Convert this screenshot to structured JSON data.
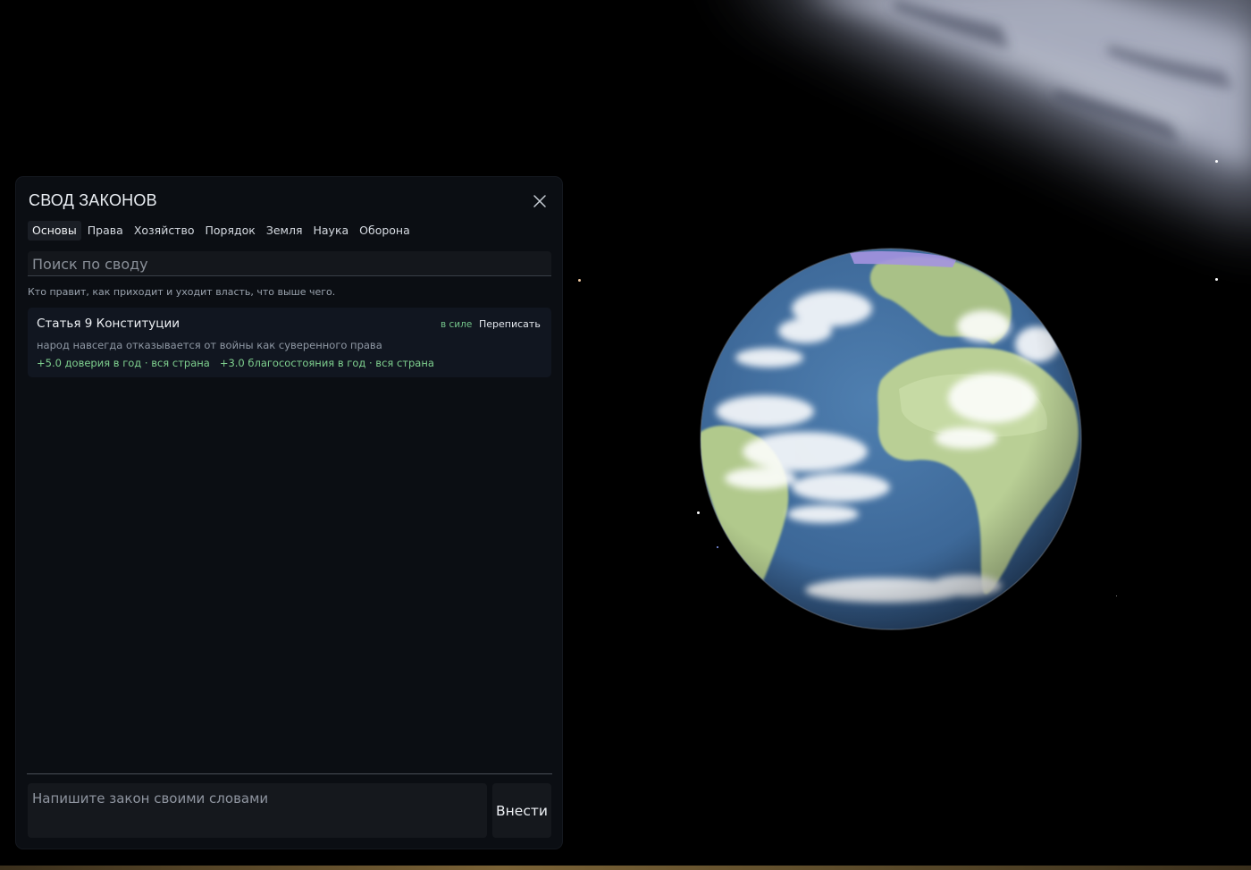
{
  "panel": {
    "title": "СВОД ЗАКОНОВ",
    "close_icon": "close-icon",
    "tabs": [
      {
        "label": "Основы",
        "active": true
      },
      {
        "label": "Права",
        "active": false
      },
      {
        "label": "Хозяйство",
        "active": false
      },
      {
        "label": "Порядок",
        "active": false
      },
      {
        "label": "Земля",
        "active": false
      },
      {
        "label": "Наука",
        "active": false
      },
      {
        "label": "Оборона",
        "active": false
      }
    ],
    "search": {
      "placeholder": "Поиск по своду",
      "value": ""
    },
    "section_description": "Кто правит, как приходит и уходит власть, что выше чего.",
    "laws": [
      {
        "title": "Статья 9 Конституции",
        "status": "в силе",
        "action": "Переписать",
        "text": "народ навсегда отказывается от войны как суверенного права",
        "effects": [
          "+5.0 доверия в год · вся страна",
          "+3.0 благосостояния в год · вся страна"
        ]
      }
    ],
    "composer": {
      "placeholder": "Напишите закон своими словами",
      "value": "",
      "submit_label": "Внести"
    }
  },
  "colors": {
    "panel_bg": "#0b0e13",
    "status_green": "#74c48a",
    "effect_green": "#7fd18f",
    "ocean": "#3f6d9c",
    "land": "#b9cf95"
  },
  "scene": {
    "globe_icon": "earth-globe",
    "background": "starfield"
  }
}
